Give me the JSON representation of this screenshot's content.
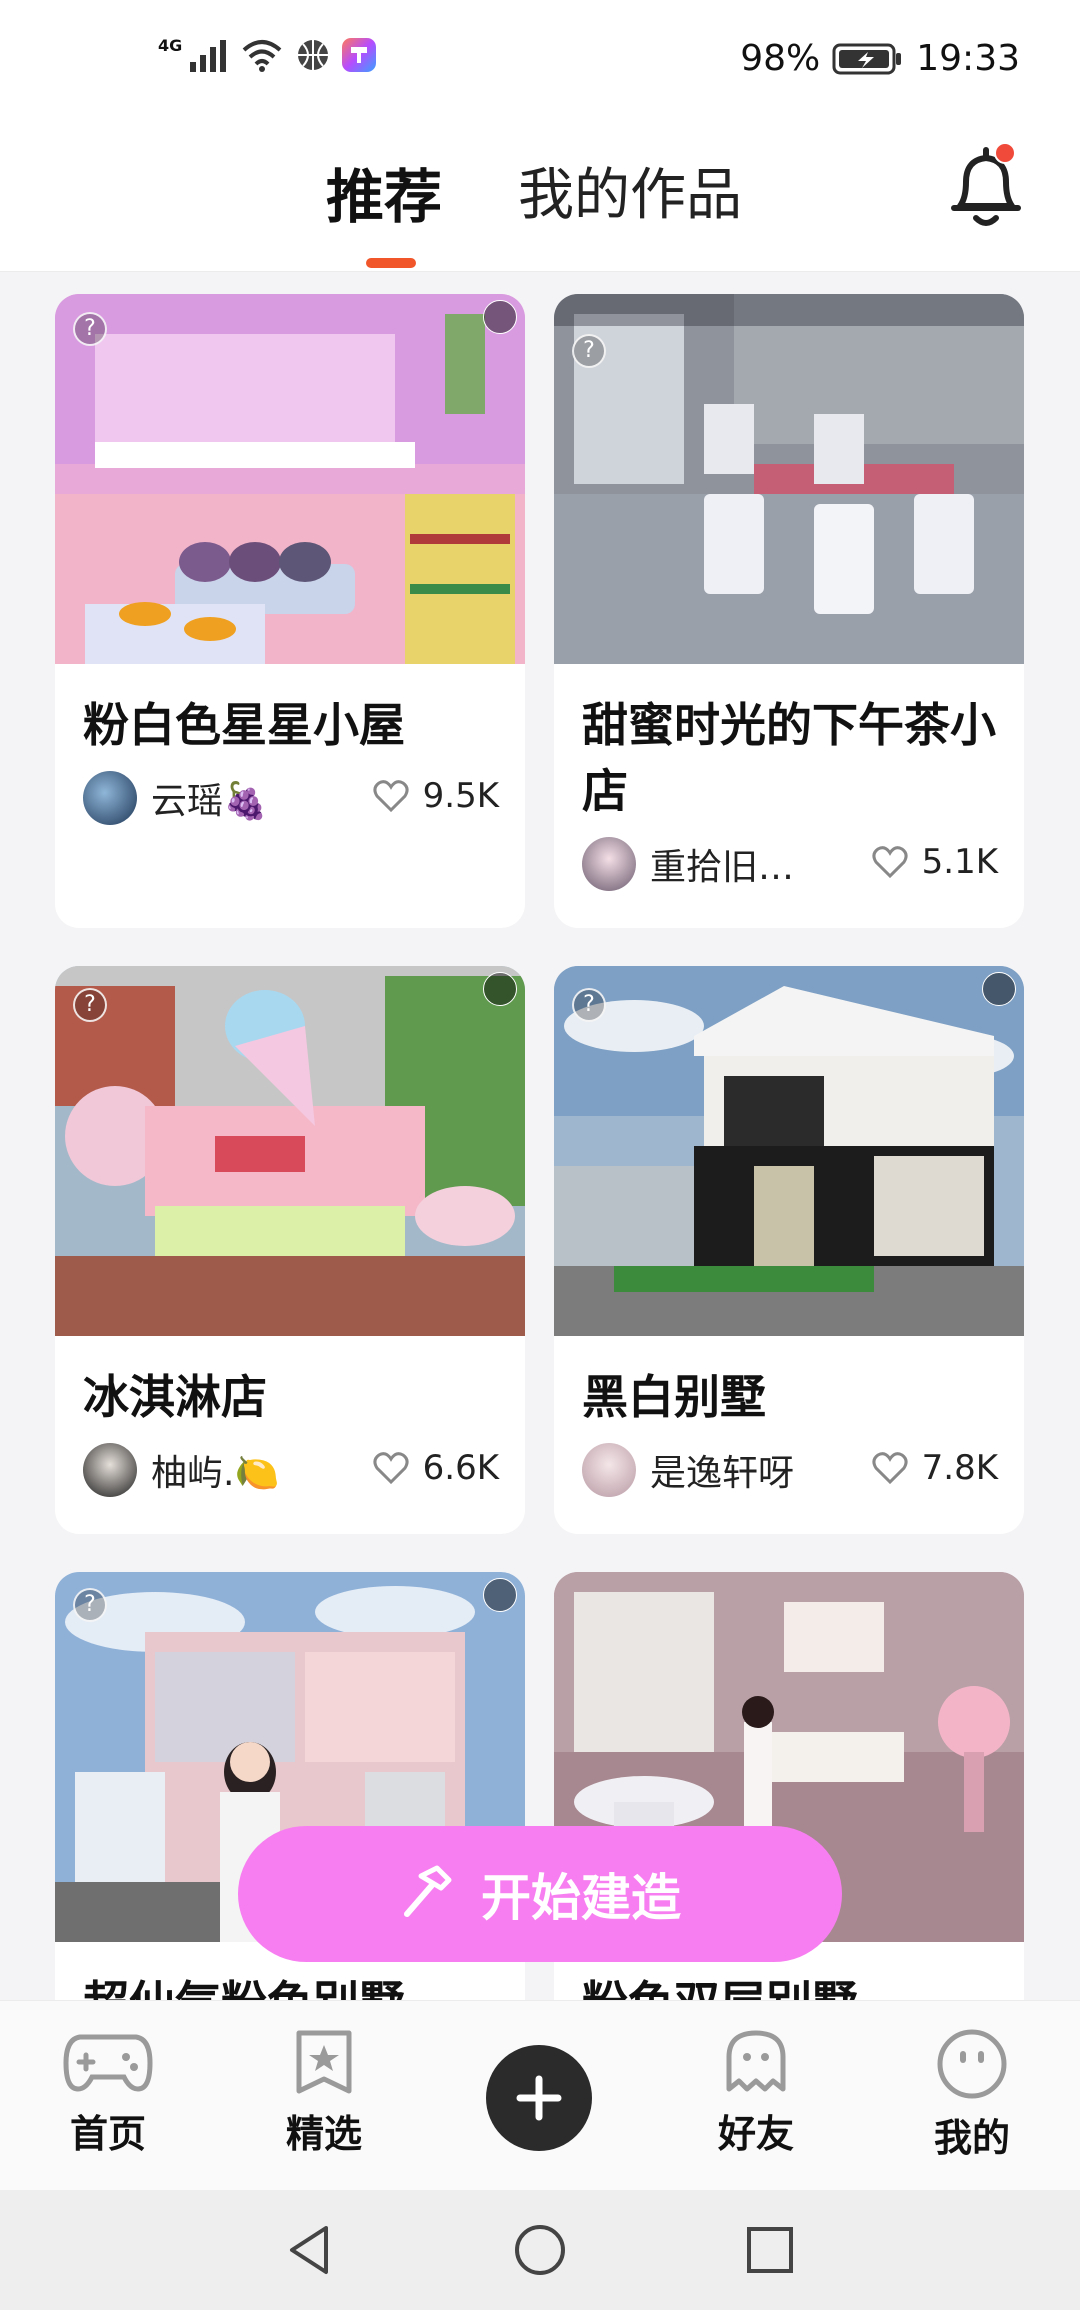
{
  "status_bar": {
    "network": "4G",
    "battery": "98%",
    "time": "19:33"
  },
  "header": {
    "tabs": [
      {
        "label": "推荐",
        "active": true
      },
      {
        "label": "我的作品",
        "active": false
      }
    ],
    "has_notification": true,
    "accent": "#f0562a"
  },
  "feed": {
    "cards": [
      {
        "title": "粉白色星星小屋",
        "author": "云瑶🍇",
        "likes": "9.5K"
      },
      {
        "title": "甜蜜时光的下午茶小店",
        "author": "重拾旧…",
        "likes": "5.1K"
      },
      {
        "title": "冰淇淋店",
        "author": "柚屿.🍋",
        "likes": "6.6K"
      },
      {
        "title": "黑白别墅",
        "author": "是逸轩呀",
        "likes": "7.8K"
      },
      {
        "title": "超仙气粉色别墅",
        "author": "",
        "likes": ""
      },
      {
        "title": "粉色双层别墅",
        "author": "",
        "likes": ""
      }
    ]
  },
  "build_button": {
    "label": "开始建造",
    "color": "#f77ef0"
  },
  "bottom_nav": {
    "items": [
      {
        "label": "首页",
        "icon": "gamepad-icon"
      },
      {
        "label": "精选",
        "icon": "star-bookmark-icon"
      },
      {
        "label": "",
        "icon": "plus-icon"
      },
      {
        "label": "好友",
        "icon": "ghost-icon"
      },
      {
        "label": "我的",
        "icon": "smiley-icon"
      }
    ]
  }
}
